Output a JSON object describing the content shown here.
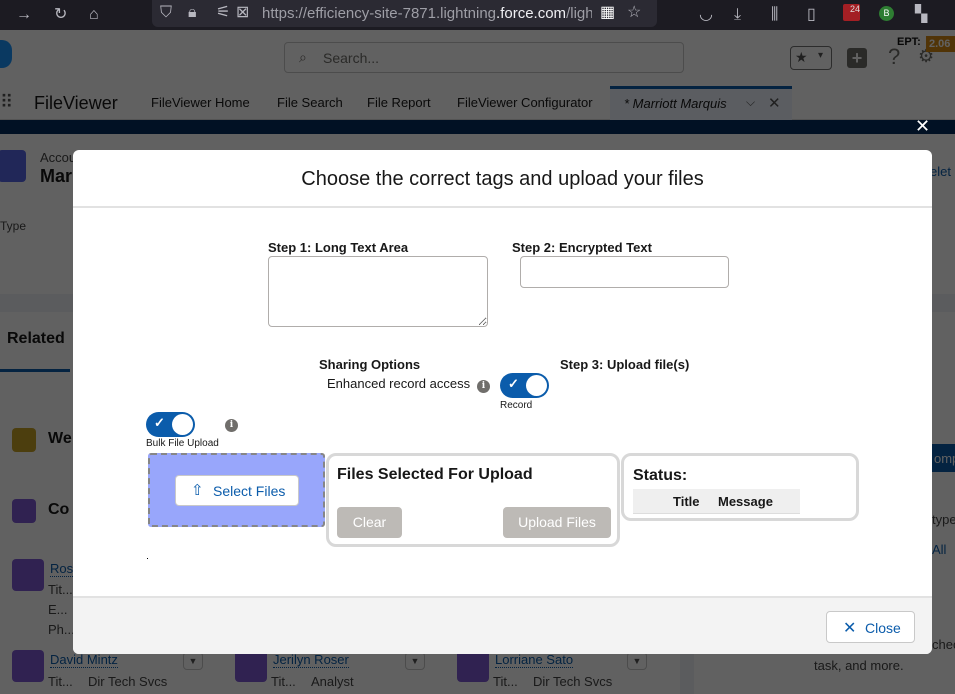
{
  "browser": {
    "url_host": "https://efficiency-site-7871.lightning",
    "url_domain": ".force.com",
    "url_path": "/light",
    "notification_count": "24",
    "profile_initial": "B"
  },
  "header": {
    "search_placeholder": "Search...",
    "ept_label": "EPT:",
    "ept_value": "2.06"
  },
  "nav": {
    "app_name": "FileViewer",
    "items": [
      {
        "label": "FileViewer Home"
      },
      {
        "label": "File Search"
      },
      {
        "label": "File Report"
      },
      {
        "label": "FileViewer Configurator"
      }
    ],
    "active_tab": "* Marriott Marquis"
  },
  "background": {
    "account_label": "Accou",
    "account_name": "Mar",
    "type_label": "Type",
    "related_tab": "Related",
    "section_1": "We",
    "section_2": "Co",
    "right_link_fragment": "elet",
    "right_button_fragment": "omp",
    "right_text_1": "type",
    "right_link_all": "All",
    "right_text_2": "chec",
    "right_text_3": "task, and more.",
    "contacts": [
      {
        "name": "Ros",
        "lines": [
          "Tit...",
          "E...",
          "Ph..."
        ]
      },
      {
        "name": "David Mintz",
        "title_label": "Tit...",
        "title": "Dir Tech Svcs"
      },
      {
        "name": "Jerilyn Roser",
        "title_label": "Tit...",
        "title": "Analyst"
      },
      {
        "name": "Lorriane Sato",
        "title_label": "Tit...",
        "title": "Dir Tech Svcs"
      }
    ]
  },
  "modal": {
    "title": "Choose the correct tags and upload your files",
    "step1_label": "Step 1: Long Text Area",
    "step1_value": "",
    "step2_label": "Step 2: Encrypted Text",
    "step2_value": "",
    "sharing_label": "Sharing Options",
    "enhanced_label": "Enhanced record access",
    "record_toggle_label": "Record",
    "record_toggle_on": true,
    "step3_label": "Step 3: Upload file(s)",
    "bulk_toggle_label": "Bulk File Upload",
    "bulk_toggle_on": true,
    "select_files_label": "Select Files",
    "files_selected_title": "Files Selected For Upload",
    "clear_label": "Clear",
    "upload_label": "Upload Files",
    "status_title": "Status:",
    "status_columns": [
      "Title",
      "Message"
    ],
    "close_label": "Close"
  },
  "colors": {
    "brand_blue": "#0b5cab",
    "dropzone": "#98a6fb",
    "disabled_button": "#bdbab6",
    "ept_badge": "#d68a14"
  }
}
